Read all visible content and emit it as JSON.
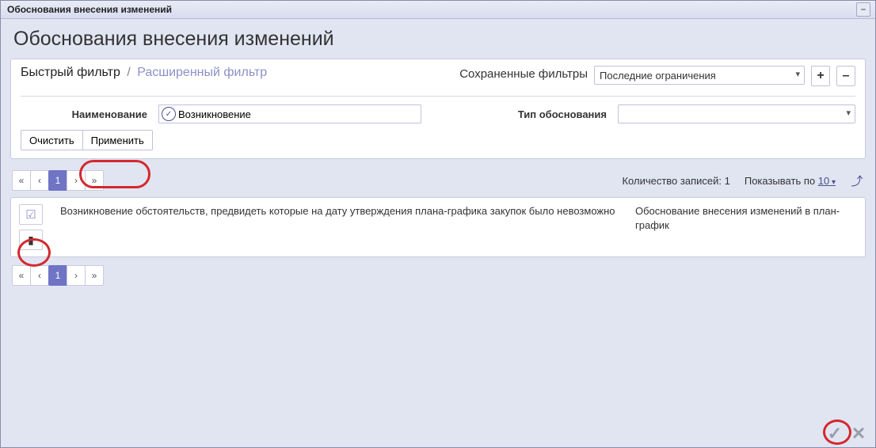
{
  "window": {
    "title": "Обоснования внесения изменений"
  },
  "page": {
    "heading": "Обоснования внесения изменений"
  },
  "filter": {
    "quick_label": "Быстрый фильтр",
    "sep": "/",
    "advanced_label": "Расширенный фильтр",
    "saved_label": "Сохраненные фильтры",
    "saved_selected": "Последние ограничения",
    "add": "+",
    "remove": "–",
    "name_label": "Наименование",
    "name_value": "Возникновение",
    "type_label": "Тип обоснования",
    "type_value": "",
    "clear": "Очистить",
    "apply": "Применить"
  },
  "pager": {
    "first": "«",
    "prev": "‹",
    "page": "1",
    "next": "›",
    "last": "»",
    "count_label": "Количество записей: 1",
    "per_label": "Показывать по",
    "per_value": "10"
  },
  "row": {
    "text": "Возникновение обстоятельств, предвидеть которые на дату утверждения плана-графика закупок было невозможно",
    "type": "Обоснование внесения изменений в план-график"
  },
  "footer": {
    "ok": "✓",
    "cancel": "✕"
  },
  "icons": {
    "collapse": "–",
    "input_ok": "✓",
    "check": "☑",
    "doc": "▮",
    "export": "⤴"
  }
}
